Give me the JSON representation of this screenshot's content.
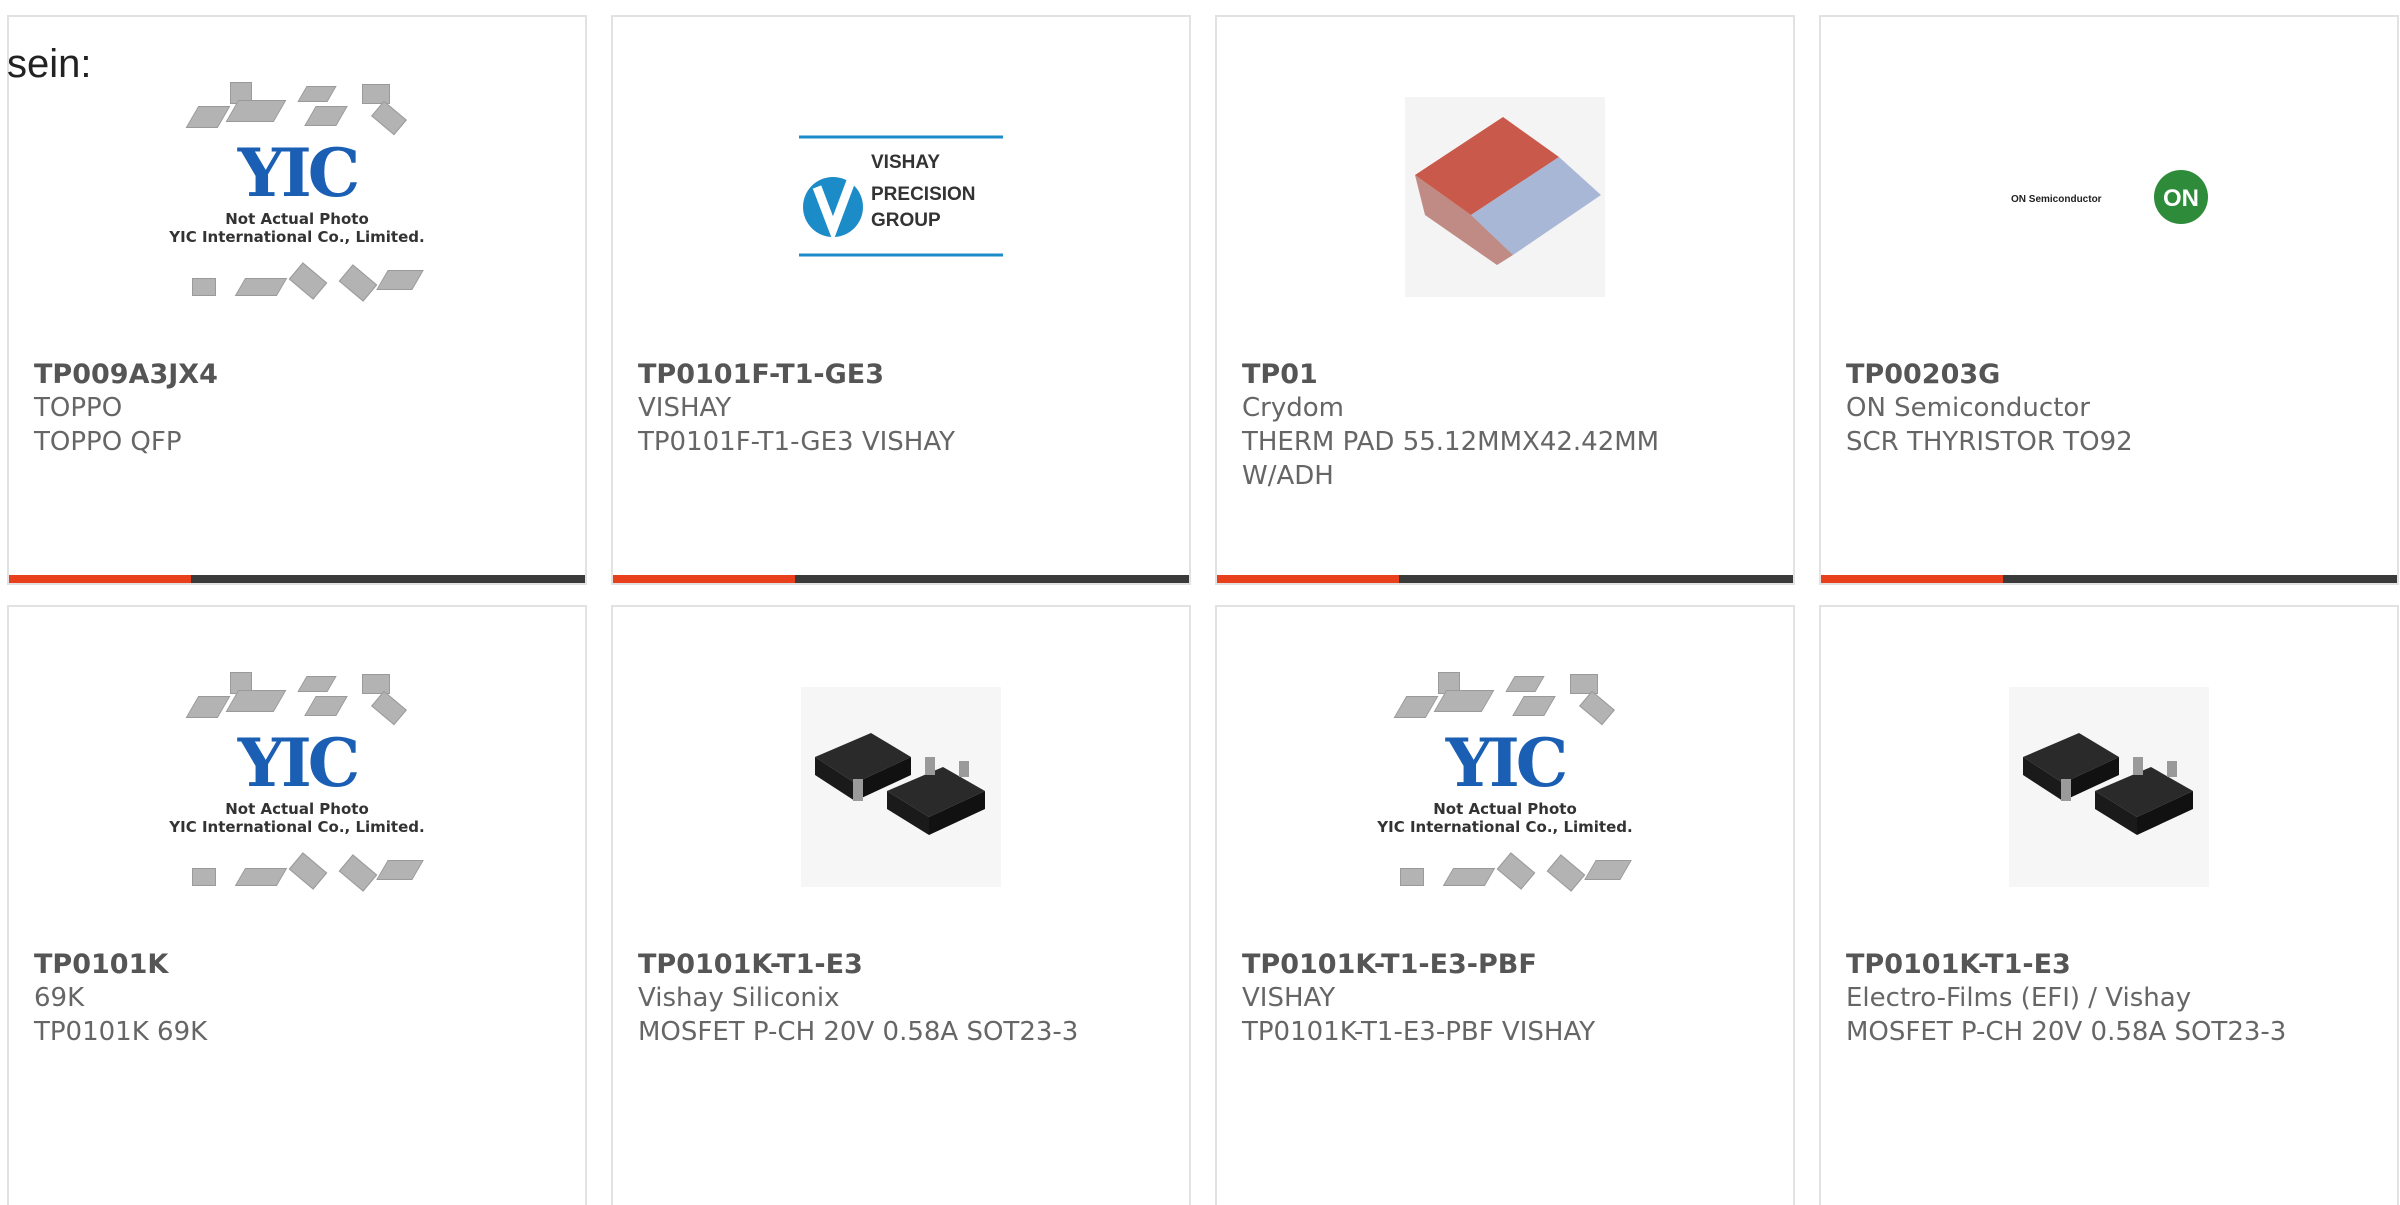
{
  "intro_text": "sein:",
  "placeholder": {
    "line1": "Not Actual Photo",
    "line2": "YIC International Co., Limited.",
    "logo": "YIC"
  },
  "brand_vishay": {
    "line1": "VISHAY",
    "line2": "PRECISION",
    "line3": "GROUP"
  },
  "brand_on": {
    "wordmark": "ON Semiconductor",
    "badge": "ON"
  },
  "colors": {
    "accent": "#e8401c",
    "bar": "#3a3a3a",
    "vishay_blue": "#1b8cc8",
    "on_green": "#2e8b3a"
  },
  "products": [
    {
      "part": "TP009A3JX4",
      "manufacturer": "TOPPO",
      "description": "TOPPO QFP",
      "image": "yic-placeholder"
    },
    {
      "part": "TP0101F-T1-GE3",
      "manufacturer": "VISHAY",
      "description": "TP0101F-T1-GE3 VISHAY",
      "image": "vishay-logo"
    },
    {
      "part": "TP01",
      "manufacturer": "Crydom",
      "description": "THERM PAD 55.12MMX42.42MM W/ADH",
      "image": "thermal-pad"
    },
    {
      "part": "TP00203G",
      "manufacturer": "ON Semiconductor",
      "description": "SCR THYRISTOR TO92",
      "image": "on-semi-logo"
    },
    {
      "part": "TP0101K",
      "manufacturer": "69K",
      "description": "TP0101K 69K",
      "image": "yic-placeholder"
    },
    {
      "part": "TP0101K-T1-E3",
      "manufacturer": "Vishay Siliconix",
      "description": "MOSFET P-CH 20V 0.58A SOT23-3",
      "image": "sot23-chip"
    },
    {
      "part": "TP0101K-T1-E3-PBF",
      "manufacturer": "VISHAY",
      "description": "TP0101K-T1-E3-PBF VISHAY",
      "image": "yic-placeholder"
    },
    {
      "part": "TP0101K-T1-E3",
      "manufacturer": "Electro-Films (EFI) / Vishay",
      "description": "MOSFET P-CH 20V 0.58A SOT23-3",
      "image": "sot23-chip"
    }
  ]
}
